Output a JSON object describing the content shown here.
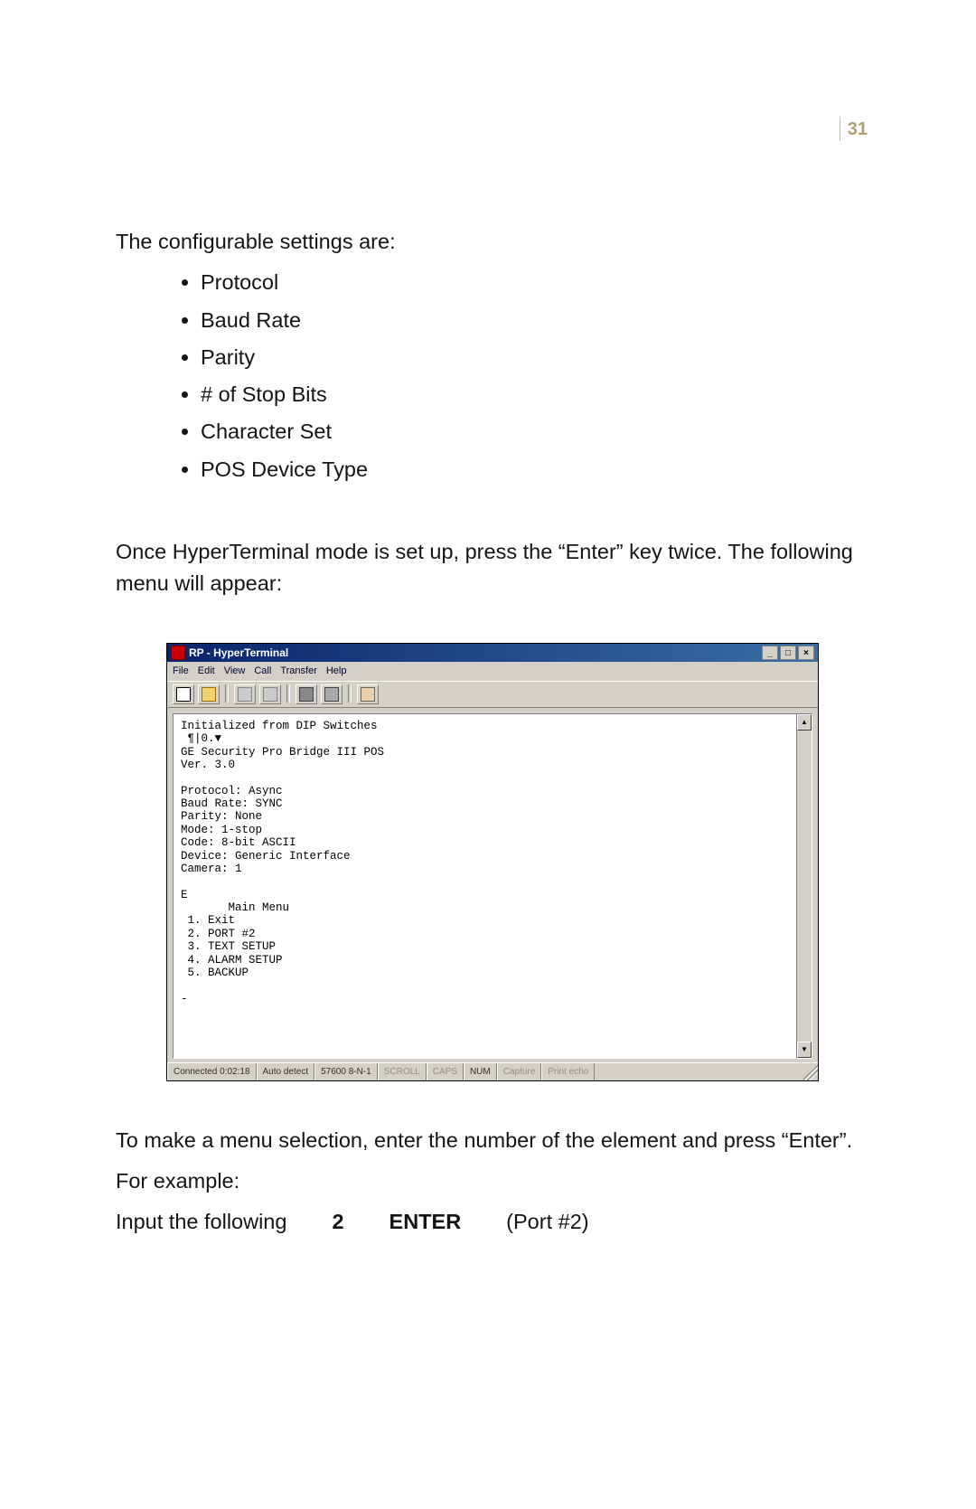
{
  "page_number": "31",
  "intro": "The configurable settings are:",
  "bullets": [
    "Protocol",
    "Baud Rate",
    "Parity",
    "# of Stop Bits",
    "Character Set",
    "POS Device Type"
  ],
  "after_bullets": "Once HyperTerminal mode is set up, press the “Enter” key twice. The following menu will appear:",
  "screenshot": {
    "title": "RP - HyperTerminal",
    "menus": [
      "File",
      "Edit",
      "View",
      "Call",
      "Transfer",
      "Help"
    ],
    "toolbar_icons": [
      "new-doc-icon",
      "open-icon",
      "dial-icon",
      "hangup-icon",
      "send-icon",
      "receive-icon",
      "properties-icon"
    ],
    "terminal_text": "Initialized from DIP Switches\n ¶|0.▼\nGE Security Pro Bridge III POS\nVer. 3.0\n\nProtocol: Async\nBaud Rate: SYNC\nParity: None\nMode: 1-stop\nCode: 8-bit ASCII\nDevice: Generic Interface\nCamera: 1\n\nE\n       Main Menu\n 1. Exit\n 2. PORT #2\n 3. TEXT SETUP\n 4. ALARM SETUP\n 5. BACKUP\n\n-",
    "status": {
      "connected": "Connected 0:02:18",
      "detect": "Auto detect",
      "settings": "57600 8-N-1",
      "scroll": "SCROLL",
      "caps": "CAPS",
      "num": "NUM",
      "capture": "Capture",
      "printecho": "Print echo"
    }
  },
  "after_shot": "To make a menu selection, enter the number of the element and press “Enter”.",
  "for_example": "For example:",
  "example": {
    "lead": "Input the following",
    "num": "2",
    "enter": "ENTER",
    "port": "(Port #2)"
  }
}
